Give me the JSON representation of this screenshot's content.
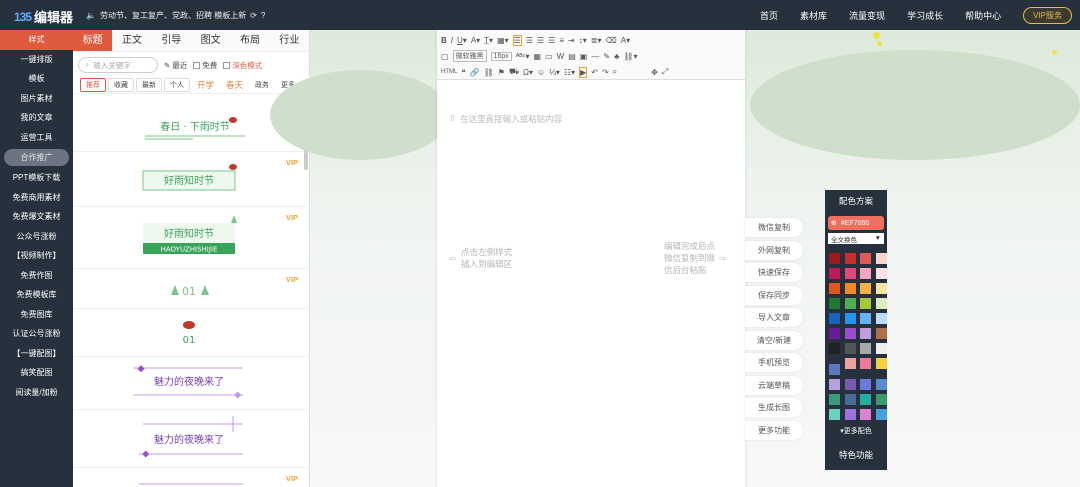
{
  "app": {
    "badge": "135",
    "name": "编辑器",
    "notice": "劳动节、复工复产、党政、招聘 模板上新"
  },
  "topnav": {
    "items": [
      "首页",
      "素材库",
      "流量变现",
      "学习成长",
      "帮助中心"
    ],
    "vip": "VIP服务"
  },
  "sidebar": {
    "items": [
      "样式",
      "一键排版",
      "模板",
      "图片素材",
      "我的文章",
      "运营工具",
      "合作推广",
      "PPT模板下载",
      "免费商用素材",
      "免费爆文素材",
      "公众号涨粉",
      "【视频制作】",
      "免费作图",
      "免费模板库",
      "免费图库",
      "认证公号涨粉",
      "【一键配图】",
      "搞笑配图",
      "阅读量/加粉"
    ]
  },
  "tabs": [
    "标题",
    "正文",
    "引导",
    "图文",
    "布局",
    "行业"
  ],
  "search": {
    "placeholder": "输入关键字"
  },
  "filters": {
    "recent": "最近",
    "free": "免费",
    "dark": "深色模式"
  },
  "subtabs": {
    "recommend": "推荐",
    "fav": "收藏",
    "new": "最新",
    "personal": "个人",
    "kaixue": "开学",
    "spring": "春天",
    "politics": "政务",
    "more": "更多"
  },
  "templates": {
    "t1": "春日 · 下雨时节",
    "t2": "好雨知时节",
    "t3": "好雨知时节",
    "t3b": "HAOYUZHISHIJIE",
    "t4": "01",
    "t5": "01",
    "t6": "魅力的夜晚来了",
    "t7": "魅力的夜晚来了",
    "vip": "VIP"
  },
  "toolbar": {
    "font": "微软雅黑",
    "size": "16px"
  },
  "editor": {
    "placeholder": "在这里直接输入或粘贴内容",
    "hint_left_1": "点击左侧样式",
    "hint_left_2": "插入到编辑区",
    "hint_right_1": "编辑完成后点",
    "hint_right_2": "微信复制到微",
    "hint_right_3": "信后台粘贴"
  },
  "actions": [
    "微信复制",
    "外网复制",
    "快速保存",
    "保存同步",
    "导入文章",
    "清空/新建",
    "手机预览",
    "云端草稿",
    "生成长图",
    "更多功能"
  ],
  "color_panel": {
    "title": "配色方案",
    "current": "#EF7060",
    "mode": "全文换色",
    "more": "更多配色",
    "feature": "特色功能",
    "swatches": [
      "#9b1b1e",
      "#c9302c",
      "#e05a5a",
      "#f7d6d0",
      "#c2185b",
      "#e0487a",
      "#f3a6c0",
      "#fbe0e8",
      "#e0561e",
      "#f08a24",
      "#f5b342",
      "#fbe3a3",
      "#1e7a2e",
      "#4caf50",
      "#a3c93a",
      "#dcecc0",
      "#1565c0",
      "#2196f3",
      "#64b5f6",
      "#bbdefb",
      "#6a1b9a",
      "#9c4dcc",
      "#c39be0",
      "#b0704a",
      "#222222",
      "#555555",
      "#aaaaaa",
      "#eeeeee",
      "#5b78c0",
      "#f0a0a0",
      "#f07a9a",
      "#f5d142",
      "#b9a0e0",
      "#7a5ab0",
      "#6a7ae0",
      "#5a8ad0",
      "#3a9a7a",
      "#4a6a9a",
      "#20b0a0",
      "#3a9a6a",
      "#6ad0c0",
      "#a070e0",
      "#e080d0",
      "#4aa0e0"
    ]
  }
}
